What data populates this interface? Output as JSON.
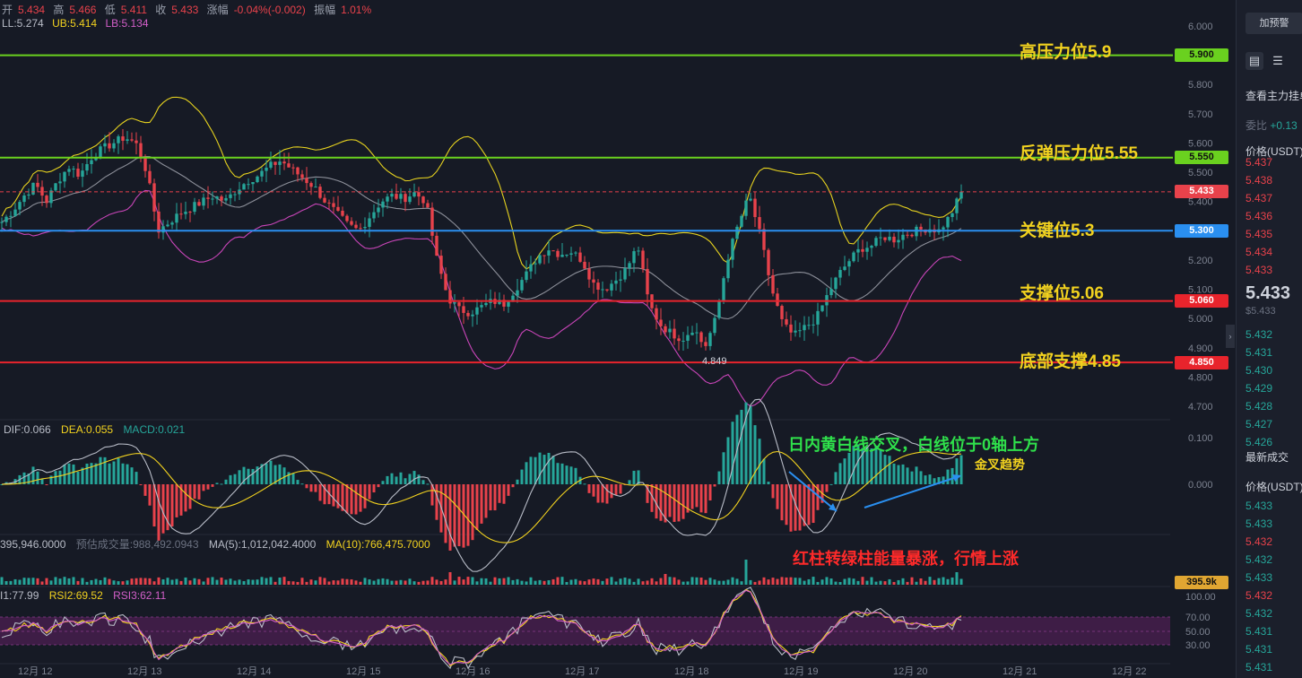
{
  "header": {
    "open_label": "开",
    "open": "5.434",
    "high_label": "高",
    "high": "5.466",
    "low_label": "低",
    "low": "5.411",
    "close_label": "收",
    "close": "5.433",
    "change_label": "涨幅",
    "change": "-0.04%(-0.002)",
    "amp_label": "振幅",
    "amp": "1.01%"
  },
  "boll": {
    "ll": "LL:5.274",
    "ub": "UB:5.414",
    "lb": "LB:5.134"
  },
  "levels": [
    {
      "label": "高压力位5.9",
      "value": 5.9,
      "tag": "5.900",
      "color": "#6ad11f"
    },
    {
      "label": "反弹压力位5.55",
      "value": 5.55,
      "tag": "5.550",
      "color": "#6ad11f"
    },
    {
      "label": "关键位5.3",
      "value": 5.3,
      "tag": "5.300",
      "color": "#2a8ff0"
    },
    {
      "label": "支撑位5.06",
      "value": 5.06,
      "tag": "5.060",
      "color": "#e8242c"
    },
    {
      "label": "底部支撑4.85",
      "value": 4.85,
      "tag": "4.850",
      "color": "#e8242c"
    }
  ],
  "current_price_tag": "5.433",
  "low_marker": "4.849",
  "macd_header": {
    "dif": "DIF:0.066",
    "dea": "DEA:0.055",
    "macd": "MACD:0.021"
  },
  "vol_header": {
    "v1": "395,946.0000",
    "v2": "预估成交量:988,492.0943",
    "ma5": "MA(5):1,012,042.4000",
    "ma10": "MA(10):766,475.7000"
  },
  "vol_tag": "395.9k",
  "rsi_header": {
    "r1": "I1:77.99",
    "r2": "RSI2:69.52",
    "r3": "RSI3:62.11"
  },
  "annotations": {
    "macd_note": "日内黄白线交叉，白线位于0轴上方",
    "golden": "金叉趋势",
    "vol_note": "红柱转绿柱能量暴涨，行情上涨"
  },
  "side": {
    "alert_button": "加预警",
    "view_orders": "查看主力挂单",
    "commission": "委比",
    "commission_val": "+0.13",
    "price_col": "价格(USDT)",
    "asks": [
      "5.437",
      "5.438",
      "5.437",
      "5.436",
      "5.435",
      "5.434",
      "5.433"
    ],
    "last_price": "5.433",
    "last_sub": "$5.433",
    "bids": [
      "5.432",
      "5.431",
      "5.430",
      "5.429",
      "5.428",
      "5.427",
      "5.426"
    ],
    "trades_title": "最新成交",
    "trades_price_col": "价格(USDT)",
    "trades": [
      {
        "p": "5.433",
        "c": "#26a69a"
      },
      {
        "p": "5.433",
        "c": "#26a69a"
      },
      {
        "p": "5.432",
        "c": "#e8424b"
      },
      {
        "p": "5.432",
        "c": "#26a69a"
      },
      {
        "p": "5.433",
        "c": "#26a69a"
      },
      {
        "p": "5.432",
        "c": "#e8424b"
      },
      {
        "p": "5.432",
        "c": "#26a69a"
      },
      {
        "p": "5.431",
        "c": "#26a69a"
      },
      {
        "p": "5.431",
        "c": "#26a69a"
      },
      {
        "p": "5.431",
        "c": "#26a69a"
      }
    ]
  },
  "chart_data": {
    "type": "candlestick",
    "price_axis": {
      "ticks": [
        "6.000",
        "5.900",
        "5.800",
        "5.700",
        "5.600",
        "5.500",
        "5.400",
        "5.300",
        "5.200",
        "5.100",
        "5.000",
        "4.900",
        "4.800",
        "4.700"
      ],
      "range": [
        4.7,
        6.0
      ]
    },
    "macd_axis": {
      "ticks": [
        "0.100",
        "0.000"
      ]
    },
    "rsi_axis": {
      "ticks": [
        "100.00",
        "70.00",
        "50.00",
        "30.00"
      ]
    },
    "x_ticks": [
      "12月 12",
      "12月 13",
      "12月 14",
      "12月 15",
      "12月 16",
      "12月 17",
      "12月 18",
      "12月 19",
      "12月 20",
      "12月 21",
      "12月 22"
    ],
    "close_path": [
      5.33,
      5.37,
      5.42,
      5.46,
      5.4,
      5.47,
      5.52,
      5.49,
      5.55,
      5.58,
      5.6,
      5.62,
      5.6,
      5.5,
      5.3,
      5.33,
      5.36,
      5.38,
      5.4,
      5.42,
      5.4,
      5.44,
      5.47,
      5.49,
      5.52,
      5.54,
      5.51,
      5.48,
      5.45,
      5.4,
      5.36,
      5.32,
      5.3,
      5.35,
      5.4,
      5.42,
      5.41,
      5.43,
      5.4,
      5.2,
      5.07,
      5.03,
      5.02,
      5.04,
      5.06,
      5.05,
      5.1,
      5.15,
      5.21,
      5.24,
      5.22,
      5.23,
      5.2,
      5.12,
      5.1,
      5.13,
      5.17,
      5.25,
      5.05,
      4.98,
      4.95,
      4.93,
      4.97,
      4.9,
      5.0,
      5.2,
      5.32,
      5.42,
      5.28,
      5.1,
      4.98,
      4.94,
      4.97,
      5.0,
      5.08,
      5.15,
      5.2,
      5.24,
      5.25,
      5.28,
      5.27,
      5.29,
      5.3,
      5.31,
      5.3,
      5.35,
      5.43
    ]
  }
}
